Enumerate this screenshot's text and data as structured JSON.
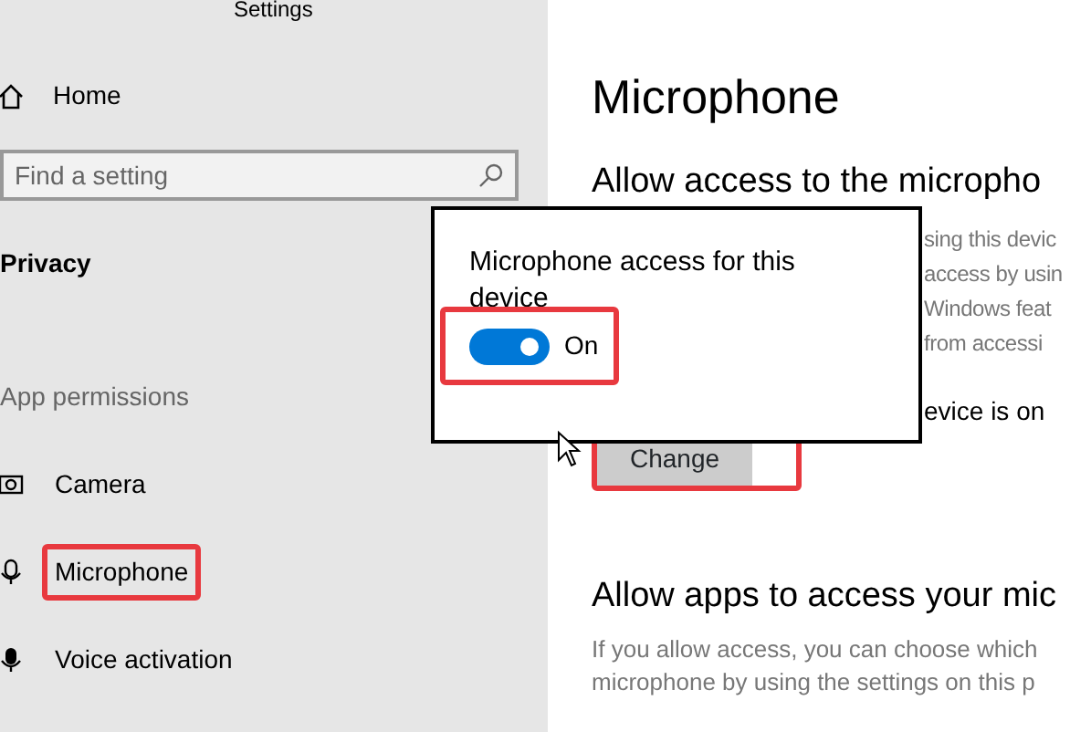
{
  "window": {
    "title": "Settings"
  },
  "sidebar": {
    "home": "Home",
    "search": {
      "placeholder": "Find a setting"
    },
    "section": "Privacy",
    "group": "App permissions",
    "items": [
      {
        "label": "Camera",
        "kind": "camera",
        "selected": false
      },
      {
        "label": "Microphone",
        "kind": "microphone",
        "selected": true
      },
      {
        "label": "Voice activation",
        "kind": "voice",
        "selected": false
      }
    ]
  },
  "main": {
    "title": "Microphone",
    "heading": "Allow access to the micropho",
    "covered_lines": [
      "sing this devic",
      "access by usin",
      "Windows feat",
      "from accessi"
    ],
    "status": "evice is on",
    "button": "Change",
    "button_highlighted": true,
    "heading_2": "Allow apps to access your mic",
    "paragraph": [
      "If you allow access, you can choose which",
      "microphone by using the settings on this p"
    ]
  },
  "popup": {
    "title": "Microphone access for this",
    "title_2": "device",
    "toggle": {
      "on": true,
      "label": "On",
      "highlighted": true
    }
  }
}
